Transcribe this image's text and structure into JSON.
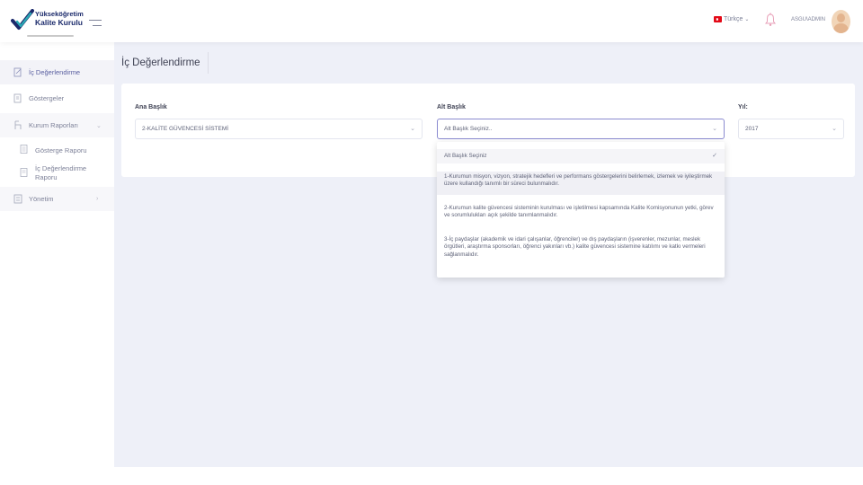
{
  "header": {
    "logo_line1": "Yükseköğretim",
    "logo_line2": "Kalite Kurulu",
    "language": "Türkçe",
    "user_name": "ASGU\\ADMIN"
  },
  "sidebar": {
    "items": [
      {
        "label": "İç Değerlendirme"
      },
      {
        "label": "Göstergeler"
      },
      {
        "label": "Kurum Raporları"
      },
      {
        "label": "Gösterge Raporu"
      },
      {
        "label": "İç Değerlendirme Raporu"
      },
      {
        "label": "Yönetim"
      }
    ]
  },
  "page": {
    "title": "İç Değerlendirme"
  },
  "form": {
    "ana_baslik_label": "Ana Başlık",
    "ana_baslik_value": "2-KALİTE GÜVENCESİ SİSTEMİ",
    "alt_baslik_label": "Alt Başlık",
    "alt_baslik_value": "Alt Başlık Seçiniz..",
    "yil_label": "Yıl:",
    "yil_value": "2017"
  },
  "dropdown": {
    "options": [
      "Alt Başlık Seçiniz",
      "1-Kurumun misyon, vizyon, stratejik hedefleri ve performans göstergelerini belirlemek, izlemek ve iyileştirmek üzere kullandığı tanımlı bir süreci bulunmalıdır.",
      "2-Kurumun kalite güvencesi sisteminin kurulması ve işletilmesi kapsamında Kalite Komisyonunun yetki, görev ve sorumlulukları açık şekilde tanımlanmalıdır.",
      "3-İç paydaşlar (akademik ve idari çalışanlar, öğrenciler) ve dış paydaşların (işverenler, mezunlar, meslek örgütleri, araştırma sponsorları, öğrenci yakınları vb.) kalite güvencesi sistemine katılımı ve katkı vermeleri sağlanmalıdır."
    ]
  },
  "colors": {
    "background": "#eef0f8",
    "brand_navy": "#1b2a6b",
    "brand_teal": "#2aa9b5",
    "flag_red": "#e30a17"
  }
}
